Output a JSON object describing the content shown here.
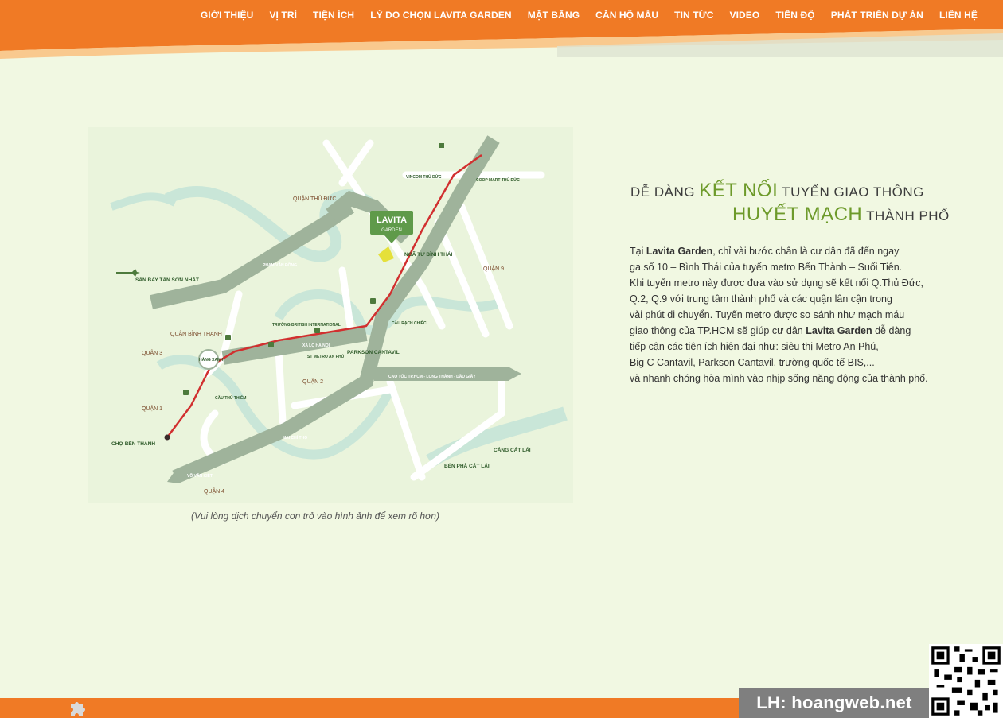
{
  "nav": {
    "items": [
      "GIỚI THIỆU",
      "VỊ TRÍ",
      "TIỆN ÍCH",
      "LÝ DO CHỌN LAVITA GARDEN",
      "MẶT BẰNG",
      "CĂN HỘ MẪU",
      "TIN TỨC",
      "VIDEO",
      "TIẾN ĐỘ",
      "PHÁT TRIỂN DỰ ÁN",
      "LIÊN HỆ"
    ]
  },
  "colors": {
    "accent": "#f07a25",
    "green": "#6d9a2a",
    "background": "#f1f8e2"
  },
  "map": {
    "labels": {
      "lavita": "LAVITA",
      "garden": "GARDEN",
      "quan_thu_duc": "QUẬN THỦ ĐỨC",
      "quan_9": "QUẬN 9",
      "quan_binh_thanh": "QUẬN BÌNH THẠNH",
      "quan_3": "QUẬN 3",
      "quan_2": "QUẬN 2",
      "quan_1": "QUẬN 1",
      "quan_4": "QUẬN 4",
      "san_bay": "SÂN BAY TÂN SƠN NHẤT",
      "ben_thanh": "CHỢ BẾN THÀNH",
      "hang_xanh": "HÀNG XANH",
      "nga_tu": "NGÃ TƯ BÌNH THÁI",
      "ben_pha": "BẾN PHÀ CÁT LÁI",
      "cang": "CẢNG CÁT LÁI",
      "parkson": "PARKSON CANTAVIL",
      "metro_an_phu": "ST METRO AN PHÚ",
      "british": "TRƯỜNG BRITISH INTERNATIONAL",
      "cau_rach_chiec": "CẦU RẠCH CHIẾC",
      "cau_thu_thiem": "CẦU THỦ THIÊM",
      "cao_toc": "CAO TỐC TP.HCM - LONG THÀNH - DẦU GIÂY",
      "xa_lo_ha_noi": "XA LỘ HÀ NỘI",
      "mai_chi_tho": "MAI CHÍ THỌ",
      "vo_van_kiet": "VÕ VĂN KIỆT",
      "pham_van_dong": "PHẠM VĂN ĐỒNG",
      "coop_mart": "COOP MART THỦ ĐỨC",
      "vincom": "VINCOM THỦ ĐỨC"
    }
  },
  "caption": "(Vui lòng dịch chuyển con trỏ vào hình ảnh để xem rõ hơn)",
  "heading": {
    "l1_a": "DỄ DÀNG ",
    "l1_hl": "KẾT NỐI",
    "l1_b": " TUYẾN GIAO THÔNG",
    "l2_hl": "HUYẾT MẠCH",
    "l2_b": " THÀNH PHỐ"
  },
  "body": {
    "p1_a": "Tại ",
    "p1_b": "Lavita Garden",
    "p1_c": ", chỉ vài bước chân là cư dân đã đến ngay",
    "p2": "ga số 10 – Bình Thái của tuyến metro Bến Thành – Suối Tiên.",
    "p3": "Khi tuyến metro này được đưa vào sử dụng sẽ kết nối Q.Thủ Đức,",
    "p4": "Q.2, Q.9 với trung tâm thành phố và các quận lân cận trong",
    "p5": "vài phút di chuyển. Tuyến metro được so sánh như mạch máu",
    "p6_a": "giao thông của TP.HCM sẽ giúp cư dân ",
    "p6_b": "Lavita Garden",
    "p6_c": " dễ dàng",
    "p7": "tiếp cận các tiện ích hiện đại như: siêu thị Metro An Phú,",
    "p8": "Big C Cantavil, Parkson Cantavil, trường quốc tế BIS,...",
    "p9": "và nhanh chóng hòa mình vào nhịp sống năng động của thành phố."
  },
  "footer": {
    "contact": "LH: hoangweb.net"
  }
}
